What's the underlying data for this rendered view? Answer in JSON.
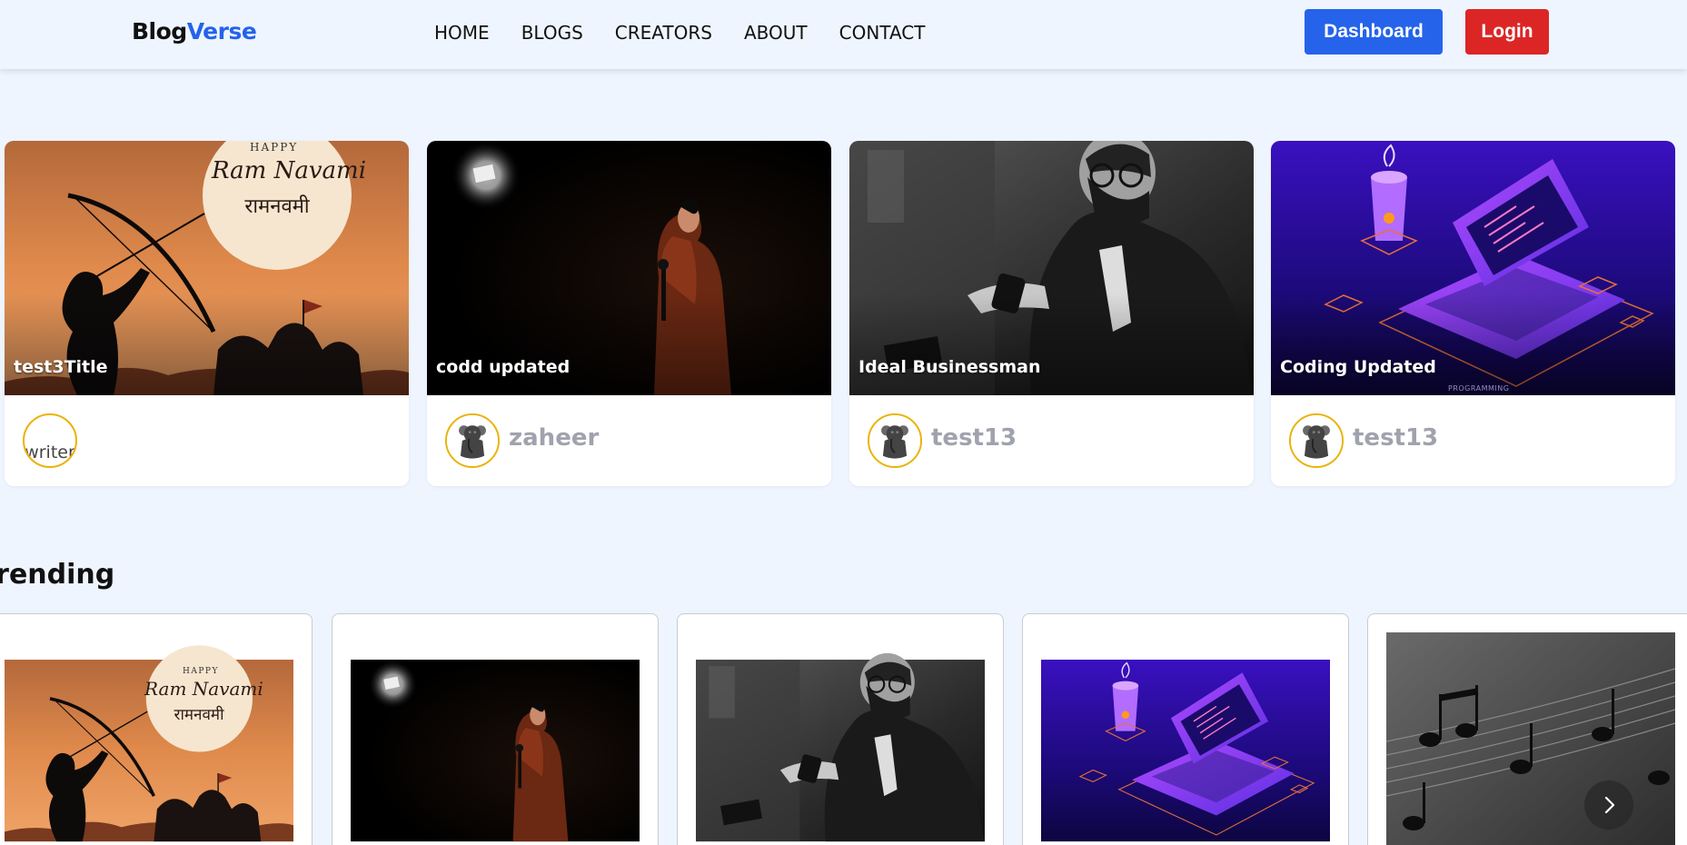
{
  "brand": {
    "part1": "Blog",
    "part2": "Verse"
  },
  "nav": {
    "links": [
      "HOME",
      "BLOGS",
      "CREATORS",
      "ABOUT",
      "CONTACT"
    ],
    "dashboard_label": "Dashboard",
    "login_label": "Login"
  },
  "featured": [
    {
      "title": "test3Title",
      "author": "",
      "avatar_alt": "writer",
      "image": "ram-navami"
    },
    {
      "title": "codd updated",
      "author": "zaheer",
      "image": "stage-performer"
    },
    {
      "title": "Ideal Businessman",
      "author": "test13",
      "image": "businessman"
    },
    {
      "title": "Coding Updated",
      "author": "test13",
      "image": "coding-laptop"
    }
  ],
  "ram_navami_art": {
    "happy": "HAPPY",
    "line1": "Ram Navami",
    "line2": "रामनवमी"
  },
  "coding_art": {
    "caption": "PROGRAMMING"
  },
  "trending": {
    "heading": "Trending",
    "images": [
      "ram-navami",
      "stage-performer",
      "businessman",
      "coding-laptop",
      "music-notes"
    ]
  },
  "colors": {
    "accent": "#2563eb",
    "login": "#dc2626",
    "avatar_ring": "#eab308",
    "background": "#eef5fe"
  }
}
